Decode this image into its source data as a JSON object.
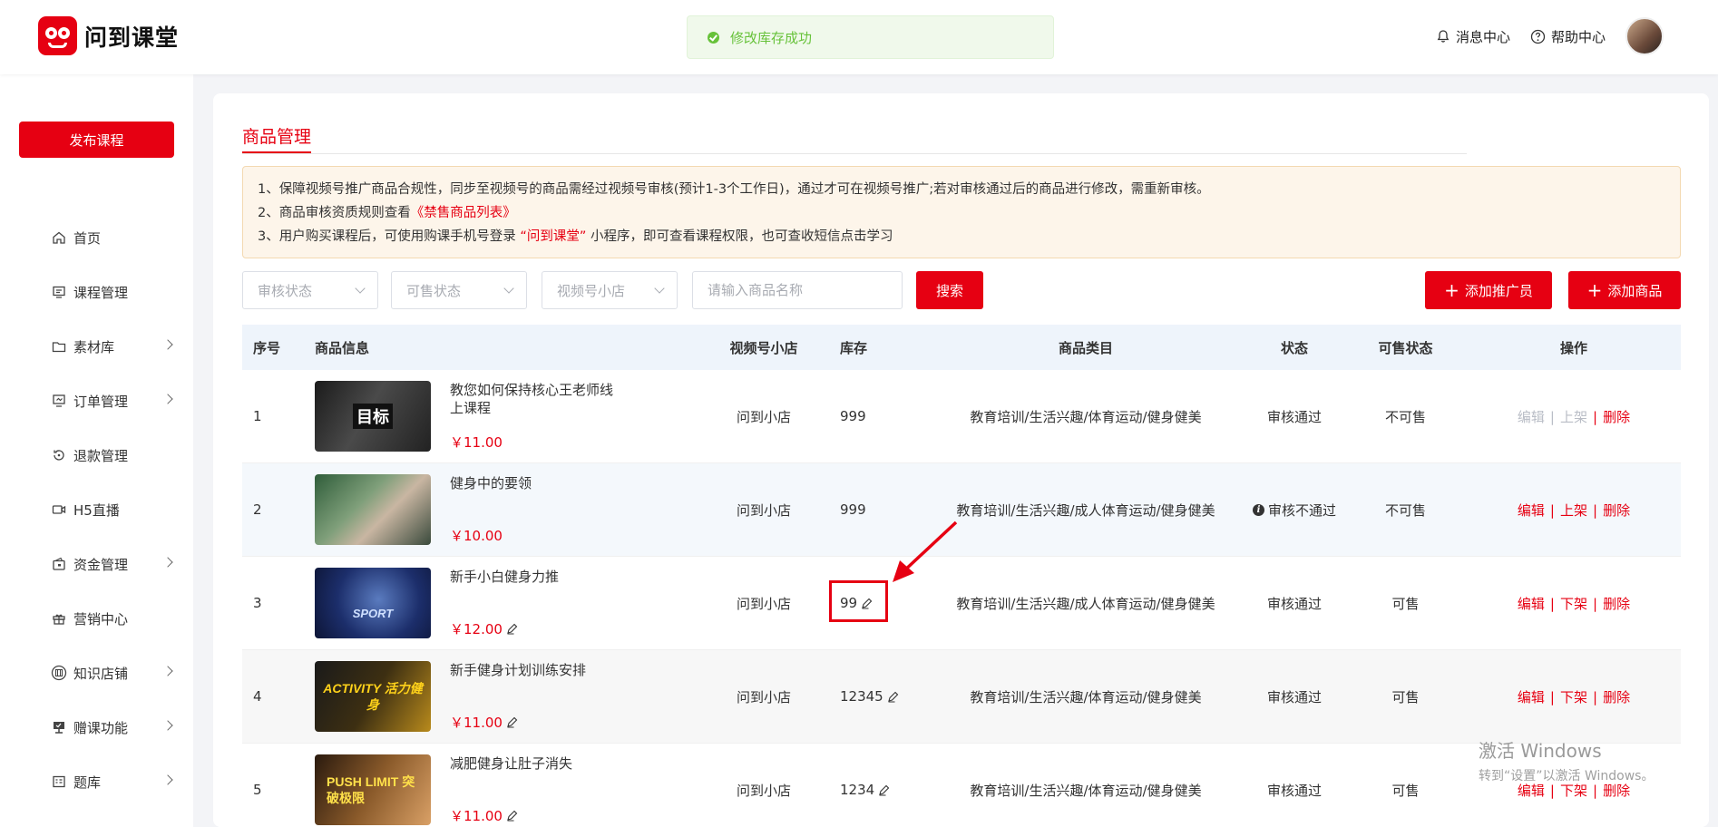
{
  "header": {
    "brand": "问到课堂",
    "toast": "修改库存成功",
    "message_center": "消息中心",
    "help_center": "帮助中心"
  },
  "sidebar": {
    "publish": "发布课程",
    "items": [
      {
        "label": "首页",
        "icon": "home-icon",
        "has_children": false
      },
      {
        "label": "课程管理",
        "icon": "course-icon",
        "has_children": false
      },
      {
        "label": "素材库",
        "icon": "folder-icon",
        "has_children": true
      },
      {
        "label": "订单管理",
        "icon": "order-icon",
        "has_children": true
      },
      {
        "label": "退款管理",
        "icon": "refund-icon",
        "has_children": false
      },
      {
        "label": "H5直播",
        "icon": "live-icon",
        "has_children": false
      },
      {
        "label": "资金管理",
        "icon": "wallet-icon",
        "has_children": true
      },
      {
        "label": "营销中心",
        "icon": "gift-icon",
        "has_children": false
      },
      {
        "label": "知识店铺",
        "icon": "shop-icon",
        "has_children": true
      },
      {
        "label": "赠课功能",
        "icon": "present-icon",
        "has_children": true
      },
      {
        "label": "题库",
        "icon": "question-bank-icon",
        "has_children": true
      }
    ]
  },
  "page": {
    "tab": "商品管理",
    "notice": {
      "line1": "1、保障视频号推广商品合规性，同步至视频号的商品需经过视频号审核(预计1-3个工作日)，通过才可在视频号推广;若对审核通过后的商品进行修改，需重新审核。",
      "line2_prefix": "2、商品审核资质规则查看",
      "line2_link": "《禁售商品列表》",
      "line3_prefix": "3、用户购买课程后，可使用购课手机号登录",
      "line3_highlight": "“问到课堂”",
      "line3_suffix": "小程序，即可查看课程权限，也可查收短信点击学习"
    },
    "filters": {
      "review_status": "审核状态",
      "sale_status": "可售状态",
      "channel_shop": "视频号小店",
      "search_placeholder": "请输入商品名称",
      "search_btn": "搜索",
      "add_promoter": "添加推广员",
      "add_product": "添加商品"
    },
    "table": {
      "headers": {
        "idx": "序号",
        "info": "商品信息",
        "shop": "视频号小店",
        "stock": "库存",
        "category": "商品类目",
        "status": "状态",
        "sale": "可售状态",
        "ops": "操作"
      },
      "rows": [
        {
          "idx": "1",
          "name": "教您如何保持核心王老师线上课程",
          "price": "￥11.00",
          "shop": "问到小店",
          "stock": "999",
          "category": "教育培训/生活兴趣/体育运动/健身健美",
          "status": "审核通过",
          "sale": "不可售",
          "op1": "编辑",
          "op2": "上架",
          "op3": "删除",
          "thumb_text": "目标"
        },
        {
          "idx": "2",
          "name": "健身中的要领",
          "price": "￥10.00",
          "shop": "问到小店",
          "stock": "999",
          "category": "教育培训/生活兴趣/成人体育运动/健身健美",
          "status": "审核不通过",
          "sale": "不可售",
          "op1": "编辑",
          "op2": "上架",
          "op3": "删除",
          "thumb_text": ""
        },
        {
          "idx": "3",
          "name": "新手小白健身力推",
          "price": "￥12.00",
          "shop": "问到小店",
          "stock": "99",
          "category": "教育培训/生活兴趣/成人体育运动/健身健美",
          "status": "审核通过",
          "sale": "可售",
          "op1": "编辑",
          "op2": "下架",
          "op3": "删除",
          "thumb_text": "SPORT"
        },
        {
          "idx": "4",
          "name": "新手健身计划训练安排",
          "price": "￥11.00",
          "shop": "问到小店",
          "stock": "12345",
          "category": "教育培训/生活兴趣/体育运动/健身健美",
          "status": "审核通过",
          "sale": "可售",
          "op1": "编辑",
          "op2": "下架",
          "op3": "删除",
          "thumb_text": "ACTIVITY 活力健身"
        },
        {
          "idx": "5",
          "name": "减肥健身让肚子消失",
          "price": "￥11.00",
          "shop": "问到小店",
          "stock": "1234",
          "category": "教育培训/生活兴趣/体育运动/健身健美",
          "status": "审核通过",
          "sale": "可售",
          "op1": "编辑",
          "op2": "下架",
          "op3": "删除",
          "thumb_text": "PUSH LIMIT 突破极限"
        }
      ]
    }
  },
  "watermark": {
    "title": "激活 Windows",
    "sub": "转到“设置”以激活 Windows。"
  }
}
